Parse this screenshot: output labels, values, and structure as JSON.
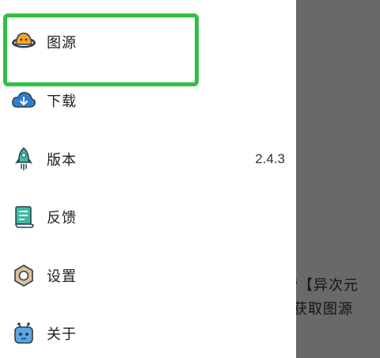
{
  "menu": {
    "items": [
      {
        "label": "图源",
        "icon": "gallery-source-icon"
      },
      {
        "label": "下载",
        "icon": "cloud-download-icon"
      },
      {
        "label": "版本",
        "icon": "rocket-icon",
        "value": "2.4.3"
      },
      {
        "label": "反馈",
        "icon": "feedback-document-icon"
      },
      {
        "label": "设置",
        "icon": "settings-hex-icon"
      },
      {
        "label": "关于",
        "icon": "about-robot-icon"
      }
    ]
  },
  "background": {
    "line1": "索【异次元",
    "line2": "获取图源"
  },
  "colors": {
    "highlight": "#2fbf45",
    "scrim": "#696969",
    "icon_teal": "#3fb9a0",
    "icon_blue": "#2f7fd0"
  }
}
